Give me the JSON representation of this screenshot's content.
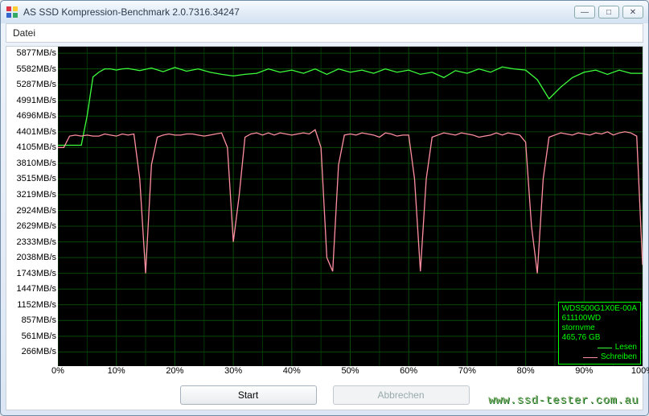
{
  "window": {
    "title": "AS SSD Kompression-Benchmark 2.0.7316.34247",
    "buttons": {
      "min": "―",
      "max": "□",
      "close": "✕"
    }
  },
  "menu": {
    "file": "Datei"
  },
  "buttons": {
    "start": "Start",
    "cancel": "Abbrechen"
  },
  "legend": {
    "line1": "WDS500G1X0E-00A",
    "line2": "611100WD",
    "line3": "stornvme",
    "line4": "465,76 GB",
    "read": "Lesen",
    "write": "Schreiben"
  },
  "watermark": "www.ssd-tester.com.au",
  "chart_data": {
    "type": "line",
    "xlabel": "",
    "ylabel": "",
    "xlim": [
      0,
      100
    ],
    "ylim": [
      0,
      6000
    ],
    "x_ticks": [
      "0%",
      "10%",
      "20%",
      "30%",
      "40%",
      "50%",
      "60%",
      "70%",
      "80%",
      "90%",
      "100%"
    ],
    "y_ticks": [
      266,
      561,
      857,
      1152,
      1447,
      1743,
      2038,
      2333,
      2629,
      2924,
      3219,
      3515,
      3810,
      4105,
      4401,
      4696,
      4991,
      5287,
      5582,
      5877
    ],
    "y_tick_suffix": "MB/s",
    "series": [
      {
        "name": "Lesen",
        "color": "#3cff3c",
        "x": [
          0,
          1,
          2,
          3,
          4,
          5,
          6,
          7,
          8,
          9,
          10,
          11,
          12,
          14,
          16,
          18,
          20,
          22,
          24,
          26,
          28,
          30,
          32,
          34,
          36,
          38,
          40,
          42,
          44,
          46,
          48,
          50,
          52,
          54,
          56,
          58,
          60,
          62,
          64,
          66,
          68,
          70,
          72,
          74,
          76,
          78,
          80,
          82,
          84,
          86,
          88,
          90,
          92,
          94,
          96,
          98,
          100
        ],
        "values": [
          4148,
          4148,
          4148,
          4148,
          4148,
          4701,
          5432,
          5520,
          5582,
          5582,
          5560,
          5582,
          5590,
          5550,
          5600,
          5530,
          5610,
          5540,
          5582,
          5520,
          5480,
          5450,
          5480,
          5500,
          5582,
          5520,
          5560,
          5500,
          5582,
          5480,
          5582,
          5520,
          5560,
          5500,
          5582,
          5520,
          5560,
          5480,
          5520,
          5420,
          5550,
          5500,
          5582,
          5520,
          5620,
          5582,
          5560,
          5380,
          5020,
          5240,
          5420,
          5520,
          5560,
          5480,
          5560,
          5500,
          5500
        ]
      },
      {
        "name": "Schreiben",
        "color": "#ff8ea0",
        "x": [
          0,
          1,
          2,
          3,
          4,
          5,
          6,
          7,
          8,
          9,
          10,
          11,
          12,
          13,
          14,
          15,
          16,
          17,
          18,
          19,
          20,
          21,
          22,
          23,
          24,
          25,
          26,
          27,
          28,
          29,
          30,
          31,
          32,
          33,
          34,
          35,
          36,
          37,
          38,
          39,
          40,
          41,
          42,
          43,
          44,
          45,
          46,
          47,
          48,
          49,
          50,
          51,
          52,
          53,
          54,
          55,
          56,
          57,
          58,
          59,
          60,
          61,
          62,
          63,
          64,
          65,
          66,
          67,
          68,
          69,
          70,
          71,
          72,
          73,
          74,
          75,
          76,
          77,
          78,
          79,
          80,
          81,
          82,
          83,
          84,
          85,
          86,
          87,
          88,
          89,
          90,
          91,
          92,
          93,
          94,
          95,
          96,
          97,
          98,
          99,
          100
        ],
        "values": [
          4105,
          4105,
          4320,
          4340,
          4320,
          4340,
          4320,
          4320,
          4360,
          4340,
          4320,
          4360,
          4340,
          4360,
          3515,
          1743,
          3780,
          4300,
          4340,
          4360,
          4340,
          4340,
          4360,
          4360,
          4340,
          4320,
          4340,
          4360,
          4380,
          4105,
          2333,
          3200,
          4300,
          4360,
          4380,
          4340,
          4380,
          4340,
          4380,
          4360,
          4340,
          4360,
          4380,
          4360,
          4440,
          4105,
          2038,
          1780,
          3780,
          4340,
          4360,
          4340,
          4380,
          4360,
          4340,
          4300,
          4380,
          4360,
          4320,
          4340,
          4340,
          3515,
          1780,
          3515,
          4300,
          4340,
          4380,
          4360,
          4340,
          4380,
          4360,
          4340,
          4300,
          4320,
          4340,
          4380,
          4340,
          4380,
          4360,
          4340,
          4205,
          2629,
          1743,
          3515,
          4300,
          4340,
          4380,
          4360,
          4340,
          4380,
          4360,
          4340,
          4380,
          4360,
          4401,
          4340,
          4380,
          4401,
          4380,
          4320,
          1900
        ]
      }
    ]
  }
}
